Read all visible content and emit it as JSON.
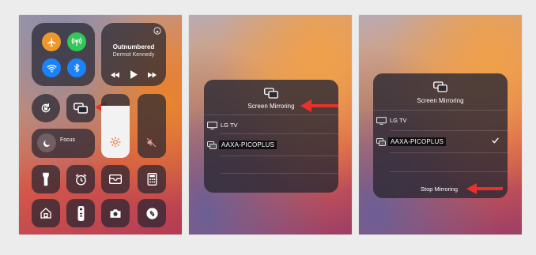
{
  "control_center": {
    "now_playing": {
      "title": "Outnumbered",
      "artist": "Dermot Kennedy"
    },
    "focus_label": "Focus"
  },
  "mirroring_list": {
    "title": "Screen Mirroring",
    "devices": [
      "LG TV",
      "AAXA-PICOPLUS"
    ]
  },
  "mirroring_connected": {
    "title": "Screen Mirroring",
    "devices": [
      "LG TV",
      "AAXA-PICOPLUS"
    ],
    "stop_label": "Stop Mirroring"
  },
  "colors": {
    "airplane_orange": "#f0972b",
    "cellular_green": "#33c659",
    "wifi_blue": "#1a82fb",
    "bluetooth_blue": "#1a82fb",
    "arrow_red": "#e8312a"
  }
}
